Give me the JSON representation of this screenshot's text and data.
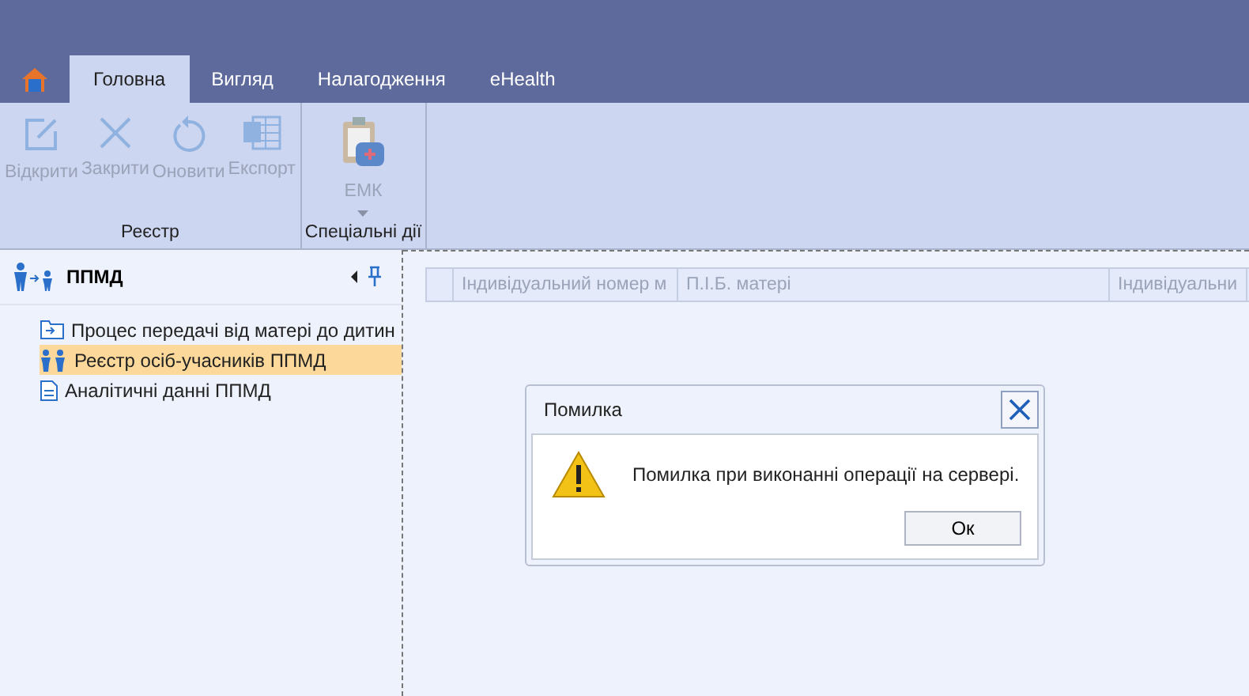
{
  "tabs": [
    {
      "label": "Головна",
      "selected": true
    },
    {
      "label": "Вигляд",
      "selected": false
    },
    {
      "label": "Налагодження",
      "selected": false
    },
    {
      "label": "eHealth",
      "selected": false
    }
  ],
  "ribbon_groups": [
    {
      "label": "Реєстр",
      "buttons": [
        {
          "label": "Відкрити",
          "disabled": true
        },
        {
          "label": "Закрити",
          "disabled": true
        },
        {
          "label": "Оновити",
          "disabled": true
        },
        {
          "label": "Експорт",
          "disabled": true
        }
      ]
    },
    {
      "label": "Спеціальні дії",
      "buttons": [
        {
          "label": "ЕМК",
          "disabled": true,
          "dropdown": true
        }
      ]
    }
  ],
  "sidebar": {
    "title": "ППМД",
    "items": [
      {
        "label": "Процес передачі від матері до дитин",
        "selected": false
      },
      {
        "label": "Реєстр осіб-учасників ППМД",
        "selected": true
      },
      {
        "label": "Аналітичні данні ППМД",
        "selected": false
      }
    ]
  },
  "table": {
    "columns": [
      "Індивідуальний номер м",
      "П.І.Б. матері",
      "Індивідуальни"
    ]
  },
  "dialog": {
    "title": "Помилка",
    "message": "Помилка при виконанні операції на сервері.",
    "buttons": [
      "Ок"
    ]
  }
}
